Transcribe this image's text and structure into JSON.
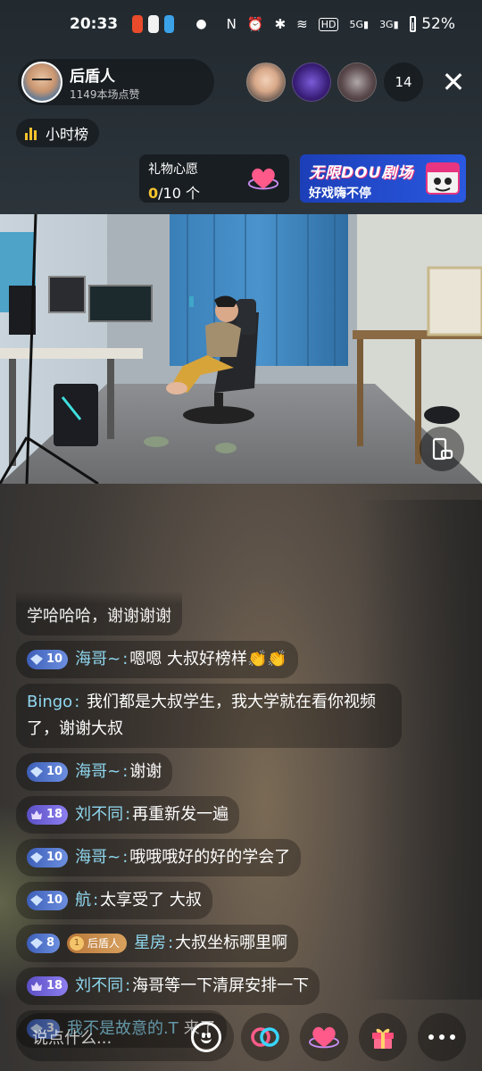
{
  "status_bar": {
    "time": "20:33",
    "battery": "52%",
    "net_5g": "5G",
    "net_3g": "3G",
    "hd": "HD"
  },
  "host": {
    "name": "后盾人",
    "likes": "1149本场点赞"
  },
  "viewer_count": "14",
  "rank_chip": "小时榜",
  "wish": {
    "title": "礼物心愿",
    "current": "0",
    "total": "/10 个"
  },
  "promo": {
    "title": "无限DOU剧场",
    "subtitle": "好戏嗨不停"
  },
  "chat": [
    {
      "id": "m0",
      "text": "学哈哈哈，谢谢谢谢"
    },
    {
      "id": "m1",
      "level": "10",
      "name": "海哥~",
      "text": "嗯嗯 大叔好榜样",
      "emoji": "👏👏"
    },
    {
      "id": "m2",
      "name": "Bingo",
      "text": "我们都是大叔学生，我大学就在看你视频了，谢谢大叔"
    },
    {
      "id": "m3",
      "level": "10",
      "name": "海哥~",
      "text": "谢谢"
    },
    {
      "id": "m4",
      "level": "18",
      "name": "刘不同",
      "text": "再重新发一遍"
    },
    {
      "id": "m5",
      "level": "10",
      "name": "海哥~",
      "text": "哦哦哦好的好的学会了"
    },
    {
      "id": "m6",
      "level": "10",
      "name": "航",
      "text": "太享受了 大叔"
    },
    {
      "id": "m7",
      "level": "8",
      "fan": "后盾人",
      "fan_level": "1",
      "name": "星房",
      "text": "大叔坐标哪里啊"
    },
    {
      "id": "m8",
      "level": "18",
      "name": "刘不同",
      "text": "海哥等一下清屏安排一下"
    },
    {
      "id": "m9",
      "level": "3",
      "name": "我不是故意的.T",
      "text": "来了"
    }
  ],
  "input": {
    "placeholder": "说点什么..."
  },
  "colors": {
    "accent_yellow": "#f5c32c",
    "name_blue": "#8fd8f0",
    "promo_blue": "#2a58e0"
  },
  "icons": {
    "rotate": "rotate-screen-icon",
    "link": "link-pk-icon",
    "heart": "heart-icon",
    "gift": "gift-icon",
    "more": "more-dots-icon"
  }
}
